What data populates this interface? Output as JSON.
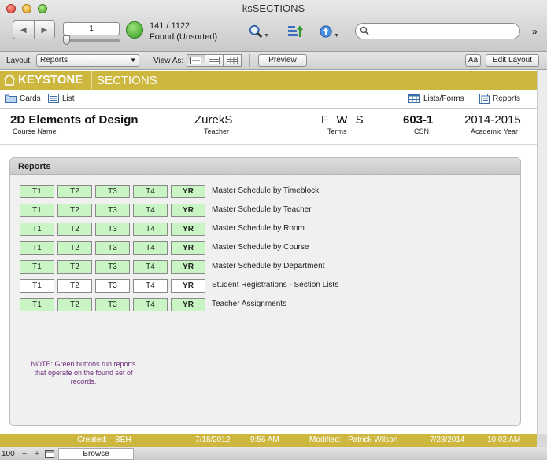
{
  "window": {
    "title": "ksSECTIONS"
  },
  "toolbar": {
    "record_number": "1",
    "found_count": "141 / 1122",
    "found_status": "Found (Unsorted)",
    "search_placeholder": "",
    "overflow_glyph": "»"
  },
  "layoutbar": {
    "layout_label": "Layout:",
    "layout_value": "Reports",
    "view_as_label": "View As:",
    "preview_label": "Preview",
    "aa_label": "Aa",
    "edit_layout_label": "Edit Layout"
  },
  "header": {
    "brand": "KEYSTONE",
    "module": "SECTIONS"
  },
  "nav": {
    "cards": "Cards",
    "list": "List",
    "lists_forms": "Lists/Forms",
    "reports": "Reports"
  },
  "record": {
    "course_name": "2D Elements of Design",
    "course_name_label": "Course Name",
    "teacher": "ZurekS",
    "teacher_label": "Teacher",
    "terms": "F W S",
    "terms_label": "Terms",
    "csn": "603-1",
    "csn_label": "CSN",
    "academic_year": "2014-2015",
    "academic_year_label": "Academic Year"
  },
  "reports": {
    "title": "Reports",
    "buttons": [
      "T1",
      "T2",
      "T3",
      "T4",
      "YR"
    ],
    "rows": [
      {
        "label": "Master Schedule by Timeblock",
        "green": true
      },
      {
        "label": "Master Schedule by Teacher",
        "green": true
      },
      {
        "label": "Master Schedule by Room",
        "green": true
      },
      {
        "label": "Master Schedule by Course",
        "green": true
      },
      {
        "label": "Master Schedule by Department",
        "green": true
      },
      {
        "label": "Student Registrations - Section Lists",
        "green": false
      },
      {
        "label": "Teacher Assignments",
        "green": true
      }
    ],
    "note": "NOTE: Green buttons run reports that operate on the found set of records."
  },
  "footer": {
    "created_label": "Created:",
    "created_by": "BEH",
    "created_date": "7/18/2012",
    "created_time": "9:56 AM",
    "modified_label": "Modified:",
    "modified_by": "Patrick Wilson",
    "modified_date": "7/28/2014",
    "modified_time": "10:02 AM"
  },
  "status": {
    "zoom": "100",
    "mode": "Browse"
  },
  "colors": {
    "brand_gold": "#cdb73e",
    "green_button": "#c8f5c3",
    "note_purple": "#6c2a7a"
  }
}
